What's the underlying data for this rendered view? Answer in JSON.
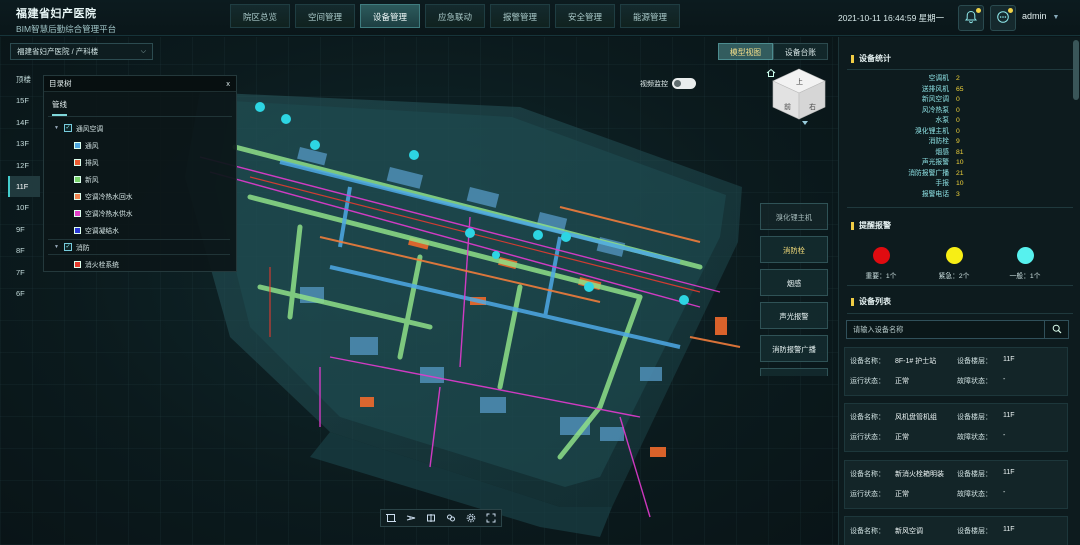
{
  "header": {
    "title": "福建省妇产医院",
    "subtitle": "BIM智慧后勤综合管理平台",
    "nav": [
      {
        "label": "院区总览"
      },
      {
        "label": "空间管理"
      },
      {
        "label": "设备管理",
        "active": true
      },
      {
        "label": "应急联动"
      },
      {
        "label": "报警管理"
      },
      {
        "label": "安全管理"
      },
      {
        "label": "能源管理"
      }
    ],
    "datetime": "2021-10-11 16:44:59 星期一",
    "user": "admin"
  },
  "viewport": {
    "breadcrumb": "福建省妇产医院 / 产科楼",
    "floors": [
      {
        "label": "顶楼"
      },
      {
        "label": "15F"
      },
      {
        "label": "14F"
      },
      {
        "label": "13F"
      },
      {
        "label": "12F"
      },
      {
        "label": "11F",
        "active": true
      },
      {
        "label": "10F"
      },
      {
        "label": "9F"
      },
      {
        "label": "8F"
      },
      {
        "label": "7F"
      },
      {
        "label": "6F"
      }
    ],
    "tree_panel": {
      "title": "目录树",
      "close": "x",
      "tab": "管线",
      "groups": [
        {
          "label": "通风空调",
          "children": [
            {
              "label": "通风",
              "color": "#4fa7e0"
            },
            {
              "label": "排风",
              "color": "#ea5b32"
            },
            {
              "label": "新风",
              "color": "#79d36b"
            },
            {
              "label": "空调冷热水回水",
              "color": "#f08552"
            },
            {
              "label": "空调冷热水供水",
              "color": "#e23fc8"
            },
            {
              "label": "空调凝结水",
              "color": "#2a38d6"
            }
          ]
        },
        {
          "label": "消防",
          "children": [
            {
              "label": "消火栓系统",
              "color": "#e23a2c"
            }
          ]
        }
      ]
    },
    "video_monitor_label": "视频监控",
    "view_tabs": [
      {
        "label": "模型视图",
        "active": true
      },
      {
        "label": "设备台账"
      }
    ],
    "cube": {
      "top": "上",
      "left": "前",
      "right": "右"
    },
    "systems": [
      {
        "label": "溴化锂主机",
        "state": "faded"
      },
      {
        "label": "消防栓",
        "state": "active"
      },
      {
        "label": "烟感",
        "state": "normal"
      },
      {
        "label": "声光报警",
        "state": "normal"
      },
      {
        "label": "消防报警广播",
        "state": "normal"
      }
    ],
    "toolbar_icons": [
      "frame-icon",
      "measure-icon",
      "section-icon",
      "layers-icon",
      "settings-icon",
      "fullscreen-icon"
    ]
  },
  "stats": {
    "title": "设备统计",
    "items": [
      {
        "name": "空调机",
        "value": "2"
      },
      {
        "name": "送排风机",
        "value": "65"
      },
      {
        "name": "新风空调",
        "value": "0"
      },
      {
        "name": "风冷热泵",
        "value": "0"
      },
      {
        "name": "水泵",
        "value": "0"
      },
      {
        "name": "溴化锂主机",
        "value": "0"
      },
      {
        "name": "消防栓",
        "value": "9"
      },
      {
        "name": "烟感",
        "value": "81"
      },
      {
        "name": "声光报警",
        "value": "10"
      },
      {
        "name": "消防报警广播",
        "value": "21"
      },
      {
        "name": "手报",
        "value": "10"
      },
      {
        "name": "报警电话",
        "value": "3"
      }
    ]
  },
  "alarms": {
    "title": "提醒报警",
    "items": [
      {
        "label": "重要：1个",
        "color": "#e00b10"
      },
      {
        "label": "紧急：2个",
        "color": "#f7ee15"
      },
      {
        "label": "一般：1个",
        "color": "#57f1ee"
      }
    ]
  },
  "device_list": {
    "title": "设备列表",
    "search_placeholder": "请输入设备名称",
    "labels": {
      "name": "设备名称：",
      "floor": "设备楼层：",
      "run": "运行状态：",
      "fault": "故障状态："
    },
    "items": [
      {
        "name": "8F-1# 护士站",
        "floor": "11F",
        "run": "正常",
        "fault": "-"
      },
      {
        "name": "风机盘管机组",
        "floor": "11F",
        "run": "正常",
        "fault": "-"
      },
      {
        "name": "新消火栓箱明装",
        "floor": "11F",
        "run": "正常",
        "fault": "-"
      },
      {
        "name": "新风空调",
        "floor": "11F"
      }
    ]
  }
}
